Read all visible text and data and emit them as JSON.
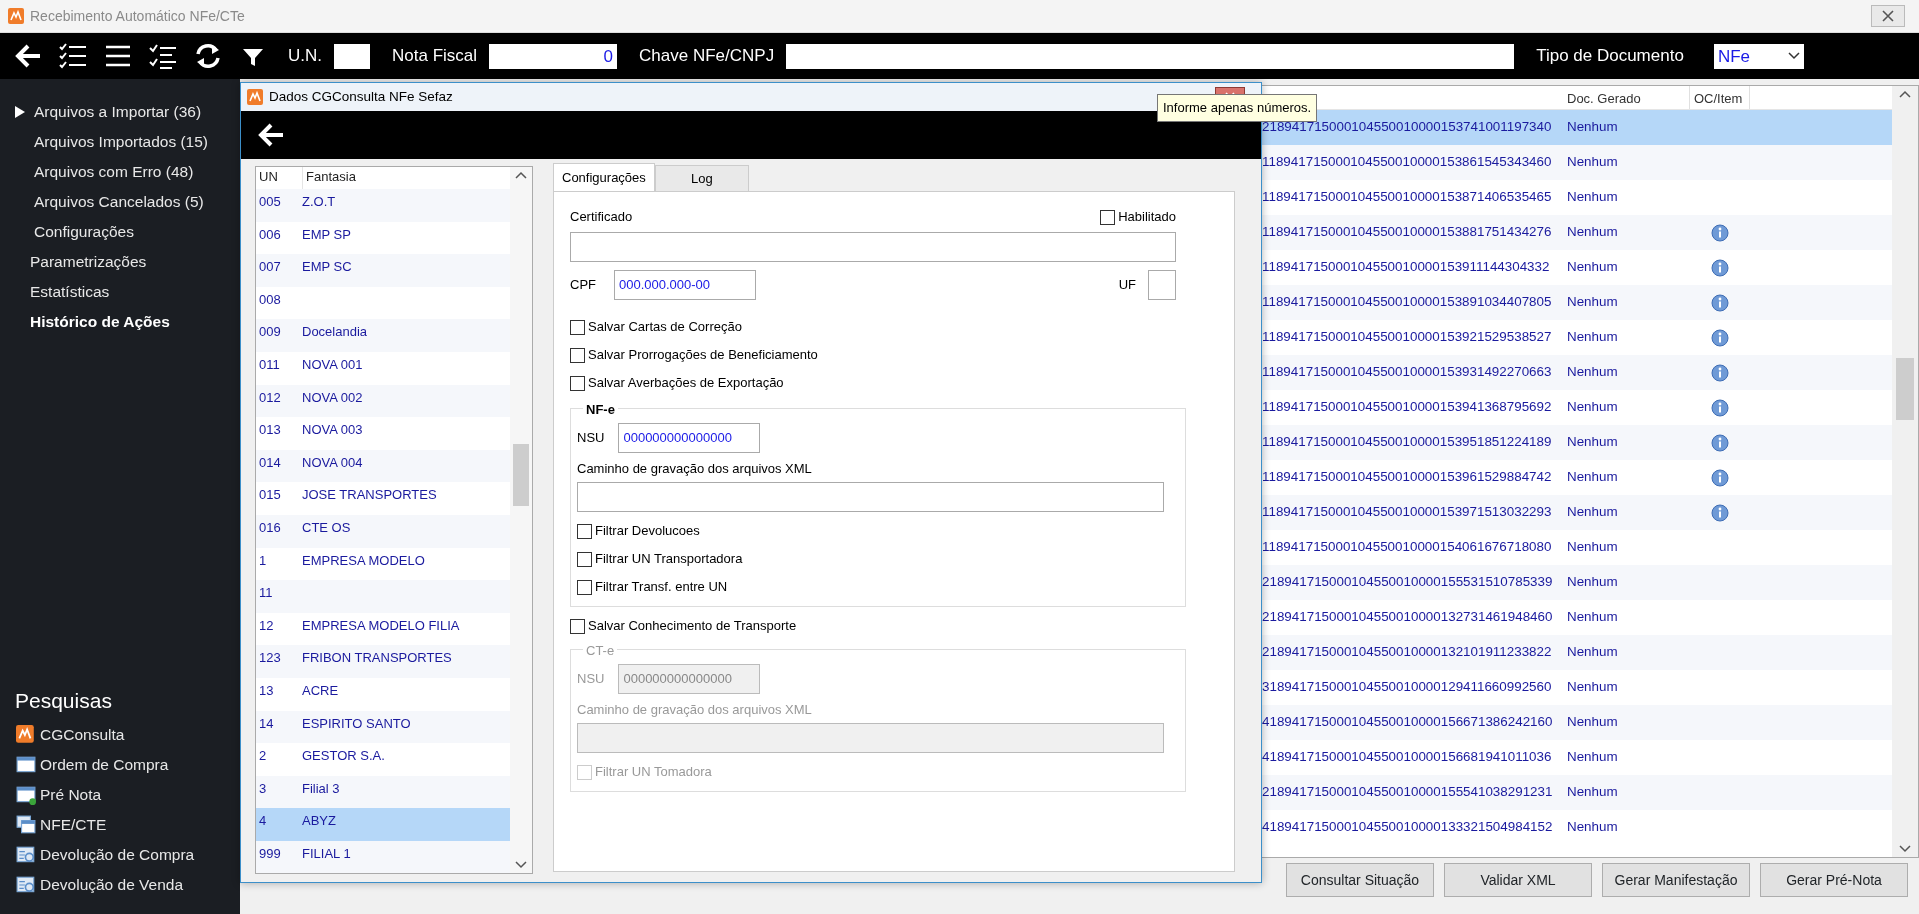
{
  "window": {
    "title": "Recebimento Automático NFe/CTe"
  },
  "toolbar": {
    "fields": [
      {
        "label": "U.N.",
        "kind": "text"
      },
      {
        "label": "Nota Fiscal",
        "kind": "number",
        "value": "0"
      },
      {
        "label": "Chave NFe/CNPJ",
        "kind": "wide"
      },
      {
        "label": "Tipo de Documento",
        "kind": "select",
        "value": "NFe"
      }
    ]
  },
  "sidebar": {
    "items": [
      {
        "label": "Arquivos a Importar (36)",
        "kind": "sub",
        "selected": true,
        "highlighted": false
      },
      {
        "label": "Arquivos Importados (15)",
        "kind": "sub",
        "selected": false,
        "highlighted": false
      },
      {
        "label": "Arquivos com Erro (48)",
        "kind": "sub",
        "selected": false,
        "highlighted": false
      },
      {
        "label": "Arquivos Cancelados (5)",
        "kind": "sub",
        "selected": false,
        "highlighted": false
      },
      {
        "label": "Configurações",
        "kind": "sub",
        "selected": false,
        "highlighted": false
      },
      {
        "label": "Parametrizações",
        "kind": "main",
        "selected": false,
        "highlighted": false
      },
      {
        "label": "Estatísticas",
        "kind": "main",
        "selected": false,
        "highlighted": false
      },
      {
        "label": "Histórico de Ações",
        "kind": "main",
        "selected": false,
        "highlighted": true
      }
    ]
  },
  "searches": {
    "title": "Pesquisas",
    "items": [
      {
        "label": "CGConsulta",
        "kind": "logo"
      },
      {
        "label": "Ordem de Compra",
        "kind": "window"
      },
      {
        "label": "Pré Nota",
        "kind": "add"
      },
      {
        "label": "NFE/CTE",
        "kind": "windows"
      },
      {
        "label": "Devolução de Compra",
        "kind": "search"
      },
      {
        "label": "Devolução de Venda",
        "kind": "search"
      }
    ]
  },
  "table": {
    "columns": [
      "Doc. Gerado",
      "OC/Item"
    ],
    "rows": [
      {
        "key": "218941715000104550010000153741001197340",
        "doc": "Nenhum",
        "info": false,
        "selected": true
      },
      {
        "key": "118941715000104550010000153861545343460",
        "doc": "Nenhum",
        "info": false,
        "selected": false
      },
      {
        "key": "118941715000104550010000153871406535465",
        "doc": "Nenhum",
        "info": false,
        "selected": false
      },
      {
        "key": "118941715000104550010000153881751434276",
        "doc": "Nenhum",
        "info": true,
        "selected": false
      },
      {
        "key": "118941715000104550010000153911144304332",
        "doc": "Nenhum",
        "info": true,
        "selected": false
      },
      {
        "key": "118941715000104550010000153891034407805",
        "doc": "Nenhum",
        "info": true,
        "selected": false
      },
      {
        "key": "118941715000104550010000153921529538527",
        "doc": "Nenhum",
        "info": true,
        "selected": false
      },
      {
        "key": "118941715000104550010000153931492270663",
        "doc": "Nenhum",
        "info": true,
        "selected": false
      },
      {
        "key": "118941715000104550010000153941368795692",
        "doc": "Nenhum",
        "info": true,
        "selected": false
      },
      {
        "key": "118941715000104550010000153951851224189",
        "doc": "Nenhum",
        "info": true,
        "selected": false
      },
      {
        "key": "118941715000104550010000153961529884742",
        "doc": "Nenhum",
        "info": true,
        "selected": false
      },
      {
        "key": "118941715000104550010000153971513032293",
        "doc": "Nenhum",
        "info": true,
        "selected": false
      },
      {
        "key": "118941715000104550010000154061676718080",
        "doc": "Nenhum",
        "info": false,
        "selected": false
      },
      {
        "key": "218941715000104550010000155531510785339",
        "doc": "Nenhum",
        "info": false,
        "selected": false
      },
      {
        "key": "218941715000104550010000132731461948460",
        "doc": "Nenhum",
        "info": false,
        "selected": false
      },
      {
        "key": "218941715000104550010000132101911233822",
        "doc": "Nenhum",
        "info": false,
        "selected": false
      },
      {
        "key": "318941715000104550010000129411660992560",
        "doc": "Nenhum",
        "info": false,
        "selected": false
      },
      {
        "key": "418941715000104550010000156671386242160",
        "doc": "Nenhum",
        "info": false,
        "selected": false
      },
      {
        "key": "418941715000104550010000156681941011036",
        "doc": "Nenhum",
        "info": false,
        "selected": false
      },
      {
        "key": "218941715000104550010000155541038291231",
        "doc": "Nenhum",
        "info": false,
        "selected": false
      },
      {
        "key": "418941715000104550010000133321504984152",
        "doc": "Nenhum",
        "info": false,
        "selected": false
      }
    ]
  },
  "buttons": [
    "Consultar Situação",
    "Validar XML",
    "Gerar Manifestação",
    "Gerar Pré-Nota"
  ],
  "tooltip": "Informe apenas números.",
  "dialog": {
    "title": "Dados CGConsulta NFe Sefaz",
    "list": {
      "columns": [
        "UN",
        "Fantasia"
      ],
      "rows": [
        {
          "un": "005",
          "name": "Z.O.T",
          "selected": false
        },
        {
          "un": "006",
          "name": "EMP SP",
          "selected": false
        },
        {
          "un": "007",
          "name": "EMP SC",
          "selected": false
        },
        {
          "un": "008",
          "selected": false
        },
        {
          "un": "009",
          "name": "Docelandia",
          "selected": false
        },
        {
          "un": "011",
          "name": "NOVA 001",
          "selected": false
        },
        {
          "un": "012",
          "name": "NOVA 002",
          "selected": false
        },
        {
          "un": "013",
          "name": "NOVA 003",
          "selected": false
        },
        {
          "un": "014",
          "name": "NOVA 004",
          "selected": false
        },
        {
          "un": "015",
          "name": "JOSE TRANSPORTES",
          "selected": false
        },
        {
          "un": "016",
          "name": "CTE OS",
          "selected": false
        },
        {
          "un": "1",
          "name": "EMPRESA MODELO",
          "selected": false
        },
        {
          "un": "11",
          "selected": false
        },
        {
          "un": "12",
          "name": "EMPRESA MODELO FILIA",
          "selected": false
        },
        {
          "un": "123",
          "name": "FRIBON TRANSPORTES",
          "selected": false
        },
        {
          "un": "13",
          "name": "ACRE",
          "selected": false
        },
        {
          "un": "14",
          "name": "ESPIRITO SANTO",
          "selected": false
        },
        {
          "un": "2",
          "name": "GESTOR S.A.",
          "selected": false
        },
        {
          "un": "3",
          "name": "Filial 3",
          "selected": false
        },
        {
          "un": "4",
          "name": "ABYZ",
          "selected": true
        },
        {
          "un": "999",
          "name": "FILIAL 1",
          "selected": false
        }
      ]
    },
    "tabs": [
      {
        "label": "Configurações",
        "selected": true
      },
      {
        "label": "Log",
        "selected": false
      }
    ],
    "config": {
      "certificado": "Certificado",
      "habilitado": {
        "label": "Habilitado",
        "checked": false
      },
      "cpf": {
        "label": "CPF",
        "value": "000.000.000-00"
      },
      "uf": {
        "label": "UF"
      },
      "options": [
        {
          "label": "Salvar Cartas de Correção",
          "checked": false
        },
        {
          "label": "Salvar Prorrogações de Beneficiamento",
          "checked": false
        },
        {
          "label": "Salvar Averbações de Exportação",
          "checked": false
        }
      ],
      "nfe": {
        "legend": "NF-e",
        "disabled": false,
        "nsu_label": "NSU",
        "nsu": "000000000000000",
        "path_label": "Caminho de gravação dos arquivos XML",
        "filters": [
          {
            "label": "Filtrar Devolucoes",
            "checked": false
          },
          {
            "label": "Filtrar UN Transportadora",
            "checked": false
          },
          {
            "label": "Filtrar Transf. entre UN",
            "checked": false
          }
        ]
      },
      "cte_option": {
        "label": "Salvar Conhecimento de Transporte",
        "checked": false
      },
      "cte": {
        "legend": "CT-e",
        "disabled": true,
        "nsu_label": "NSU",
        "nsu": "000000000000000",
        "path_label": "Caminho de gravação dos arquivos XML",
        "filters": [
          {
            "label": "Filtrar UN Tomadora",
            "checked": false
          }
        ]
      }
    }
  }
}
